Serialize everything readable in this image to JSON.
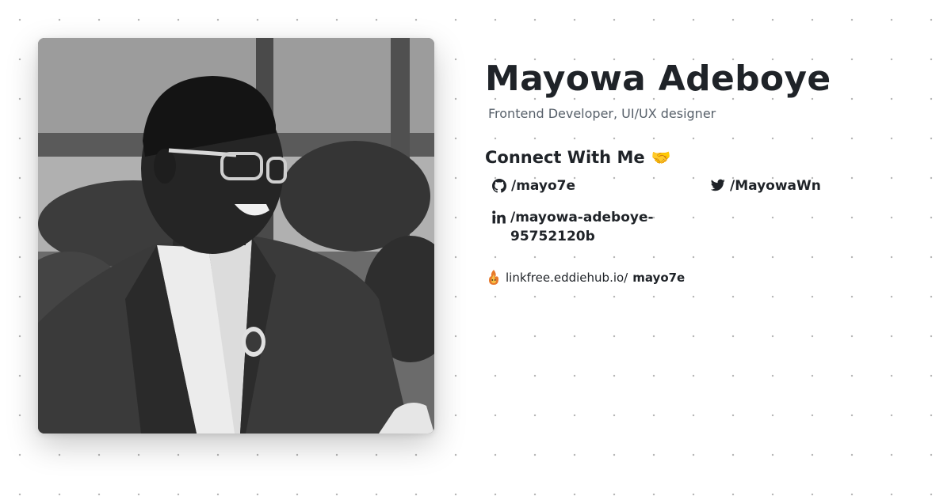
{
  "profile": {
    "name": "Mayowa Adeboye",
    "role": "Frontend Developer, UI/UX designer"
  },
  "connect": {
    "heading": "Connect With Me",
    "emoji": "🤝"
  },
  "socials": [
    {
      "icon": "github-icon",
      "handle": "/mayo7e"
    },
    {
      "icon": "twitter-icon",
      "handle": "/MayowaWn"
    },
    {
      "icon": "linkedin-icon",
      "handle": "/mayowa-adeboye-95752120b"
    }
  ],
  "linkfree": {
    "icon": "linkfree-logo-icon",
    "prefix": "linkfree.eddiehub.io/",
    "username": "mayo7e"
  },
  "photo": {
    "subject": "profile-photo",
    "style": "grayscale"
  }
}
